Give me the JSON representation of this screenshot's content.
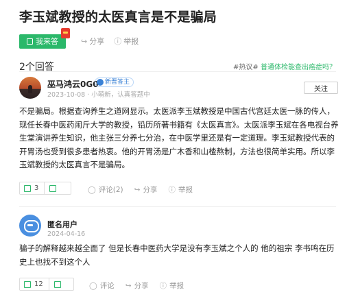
{
  "question": {
    "title": "李玉斌教授的太医真言是不是骗局",
    "answer_button": "我来答",
    "share": "分享",
    "report": "举报"
  },
  "answers_header": {
    "count": "2个回答",
    "hot_tag": "#热议#",
    "hot_link": "普通体检能查出癌症吗？"
  },
  "answers": [
    {
      "author": "巫马鸿云0G0",
      "badge": "新晋答主",
      "meta": "2023-10-08 · 小萌新，认真答题中",
      "follow": "关注",
      "body": "不是骗局。根据查询养生之道网显示。太医派李玉斌教授是中国古代宫廷太医一脉的传人，现任长春中医药闹斤大学的教授，铅历所著书籍有《太医真言》。太医派李玉斌在各电视台养生堂演讲养生知识，他主张三分养七分治，在中医学里还是有一定道理。李玉斌教授代表的开胃汤也受到很多患者热衷。他的开胃汤是广木香和山楂熬制，方法也很简单实用。所以李玉斌教授的太医真言不是骗局。",
      "likes": "3",
      "comment": "评论(2)",
      "share": "分享",
      "report": "举报"
    },
    {
      "author": "匿名用户",
      "meta": "2024-04-16",
      "body": "骗子的解释越来越全面了 但是长春中医药大学是没有李玉斌之个人的 他的祖宗 李书鸣在历史上也找不到这个人",
      "likes": "12",
      "comment": "评论",
      "share": "分享",
      "report": "举报"
    }
  ],
  "colors": {
    "accent": "#2bb86a",
    "badge": "#3b82d6",
    "redpack": "#e63b2e"
  }
}
